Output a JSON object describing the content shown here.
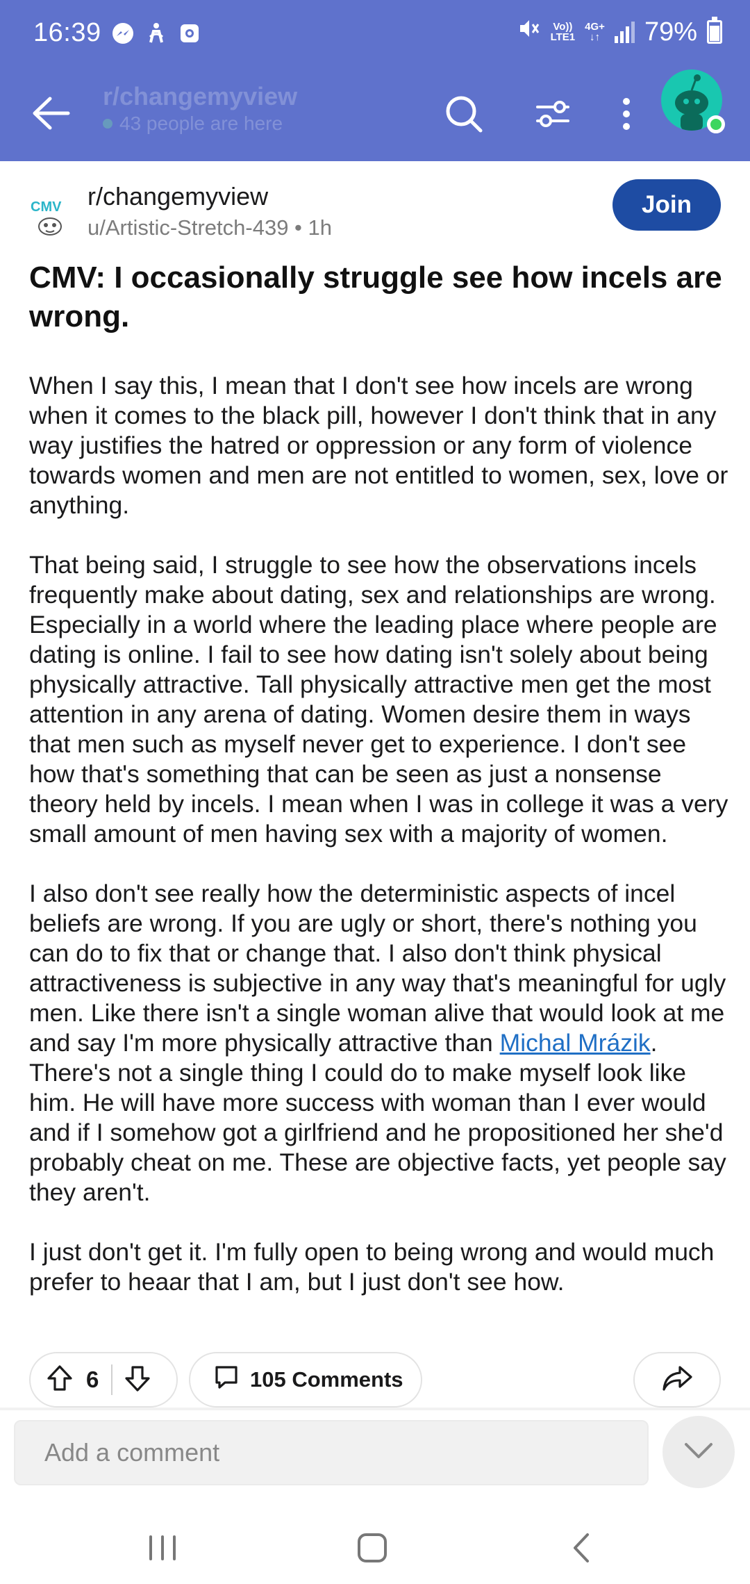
{
  "status_bar": {
    "time": "16:39",
    "net_top": "Vo))",
    "net_bottom": "LTE1",
    "net_type": "4G+",
    "battery": "79%",
    "battery_level": 0.79,
    "icons": [
      "messenger-icon",
      "accessibility-icon",
      "screen-record-icon",
      "mute-icon",
      "signal-icon",
      "battery-icon"
    ]
  },
  "header": {
    "subreddit_faded": "r/changemyview",
    "online_faded": "43 people are here",
    "icons": [
      "back-arrow-icon",
      "search-icon",
      "filter-icon",
      "more-vert-icon",
      "avatar"
    ]
  },
  "post": {
    "subreddit": "r/changemyview",
    "author_line": "u/Artistic-Stretch-439 • 1h",
    "join_label": "Join",
    "title": "CMV: I occasionally struggle see how incels are wrong.",
    "paragraphs": [
      "When I say this, I mean that I don't see how incels are wrong when it comes to the black pill, however I don't think that in any way justifies the hatred or oppression or any form of violence towards women and men are not entitled to women, sex, love or anything.",
      "That being said, I struggle to see how the observations incels frequently make about dating, sex and relationships are wrong. Especially in a world where the leading place where people are dating is online. I fail to see how dating isn't solely about being physically attractive. Tall physically attractive men get the most attention in any arena of dating. Women desire them in ways that men such as myself never get to experience. I don't see how that's something that can be seen as just a nonsense theory held by incels. I mean when I was in college it was a very small amount of men having sex with a majority of women."
    ],
    "p3_before": "I also don't see really how the deterministic aspects of incel beliefs are wrong. If you are ugly or short, there's nothing you can do to fix that or change that. I also don't think physical attractiveness is subjective in any way that's meaningful for ugly men. Like there isn't a single woman alive that would look at me and say I'm more physically attractive than ",
    "p3_link": "Michal Mrázik",
    "p3_after": ". There's not a single thing I could do to make myself look like him. He will have more success with woman than I ever would and if I somehow got a girlfriend and he propositioned her she'd probably cheat on me. These are objective facts, yet people say they aren't.",
    "p4": "I just don't get it. I'm fully open to being wrong and would much prefer to heaar that I am, but I just don't see how."
  },
  "actions": {
    "vote_count": "6",
    "comments_label": "105 Comments"
  },
  "comment_bar": {
    "placeholder": "Add a comment"
  },
  "colors": {
    "header_bg": "#5f72cc",
    "join_bg": "#1e4ca3",
    "link": "#1f6fc5",
    "avatar_bg": "#19c7b0",
    "online": "#3cd65f"
  }
}
